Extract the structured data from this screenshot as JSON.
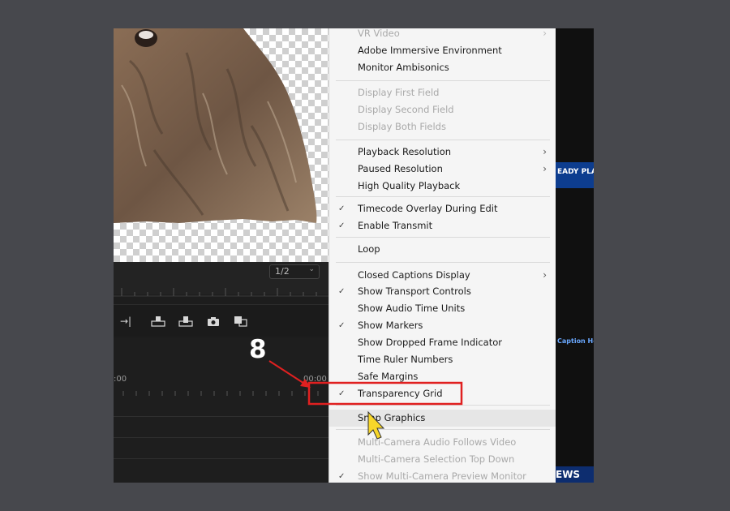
{
  "monitor": {
    "resolution_select": "1/2",
    "timecodes": [
      ":00",
      "00:00"
    ]
  },
  "right_panel": {
    "banner_text": "EADY PLAY",
    "caption_text": "Caption Here",
    "news_text": "EWS"
  },
  "menu": {
    "items": [
      {
        "label": "VR Video",
        "disabled": true,
        "checked": false,
        "submenu": true
      },
      {
        "label": "Adobe Immersive Environment",
        "disabled": false,
        "checked": false,
        "submenu": false
      },
      {
        "label": "Monitor Ambisonics",
        "disabled": false,
        "checked": false,
        "submenu": false
      },
      {
        "label": "Display First Field",
        "disabled": true,
        "checked": false,
        "submenu": false
      },
      {
        "label": "Display Second Field",
        "disabled": true,
        "checked": false,
        "submenu": false
      },
      {
        "label": "Display Both Fields",
        "disabled": true,
        "checked": false,
        "submenu": false
      },
      {
        "label": "Playback Resolution",
        "disabled": false,
        "checked": false,
        "submenu": true
      },
      {
        "label": "Paused Resolution",
        "disabled": false,
        "checked": false,
        "submenu": true
      },
      {
        "label": "High Quality Playback",
        "disabled": false,
        "checked": false,
        "submenu": false
      },
      {
        "label": "Timecode Overlay During Edit",
        "disabled": false,
        "checked": true,
        "submenu": false
      },
      {
        "label": "Enable Transmit",
        "disabled": false,
        "checked": true,
        "submenu": false
      },
      {
        "label": "Loop",
        "disabled": false,
        "checked": false,
        "submenu": false
      },
      {
        "label": "Closed Captions Display",
        "disabled": false,
        "checked": false,
        "submenu": true
      },
      {
        "label": "Show Transport Controls",
        "disabled": false,
        "checked": true,
        "submenu": false
      },
      {
        "label": "Show Audio Time Units",
        "disabled": false,
        "checked": false,
        "submenu": false
      },
      {
        "label": "Show Markers",
        "disabled": false,
        "checked": true,
        "submenu": false
      },
      {
        "label": "Show Dropped Frame Indicator",
        "disabled": false,
        "checked": false,
        "submenu": false
      },
      {
        "label": "Time Ruler Numbers",
        "disabled": false,
        "checked": false,
        "submenu": false
      },
      {
        "label": "Safe Margins",
        "disabled": false,
        "checked": false,
        "submenu": false
      },
      {
        "label": "Transparency Grid",
        "disabled": false,
        "checked": true,
        "submenu": false
      },
      {
        "label": "Snap Graphics",
        "disabled": false,
        "checked": false,
        "submenu": false
      },
      {
        "label": "Multi-Camera Audio Follows Video",
        "disabled": true,
        "checked": false,
        "submenu": false
      },
      {
        "label": "Multi-Camera Selection Top Down",
        "disabled": true,
        "checked": false,
        "submenu": false
      },
      {
        "label": "Show Multi-Camera Preview Monitor",
        "disabled": true,
        "checked": true,
        "submenu": false
      }
    ]
  },
  "annotation": {
    "step_number": "8",
    "highlight_color": "#e02020"
  },
  "icons": {
    "check": "✓",
    "submenu": "›"
  }
}
